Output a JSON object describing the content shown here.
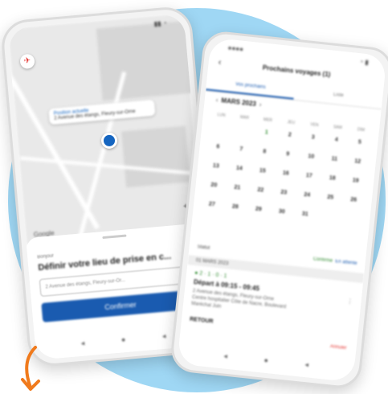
{
  "phone1": {
    "status_time": "",
    "callout": {
      "title": "Position actuelle",
      "text": "2 Avenue des étangs, Fleury-sur-Orne"
    },
    "map_brand": "Google",
    "sheet": {
      "kicker": "Bonjour",
      "title": "Définir votre lieu de prise en c...",
      "address_value": "2 Avenue des étangs, Fleury-sur-Or...",
      "confirm_label": "Confirmer"
    },
    "icons": [
      "compass-icon",
      "location-pin-icon",
      "locate-icon",
      "search-icon"
    ]
  },
  "phone2": {
    "title": "Prochains voyages (1)",
    "tabs": [
      {
        "label": "Vos prochains"
      },
      {
        "label": "Liste"
      }
    ],
    "month": "MARS 2023",
    "days_of_week": [
      "LUN",
      "MAR",
      "MER",
      "JEU",
      "VEN",
      "SAM",
      "DIM"
    ],
    "weeks": [
      [
        "",
        "",
        "1",
        "2",
        "3",
        "4",
        "5"
      ],
      [
        "6",
        "7",
        "8",
        "9",
        "10",
        "11",
        "12"
      ],
      [
        "13",
        "14",
        "15",
        "16",
        "17",
        "18",
        "19"
      ],
      [
        "20",
        "21",
        "22",
        "23",
        "24",
        "25",
        "26"
      ],
      [
        "27",
        "28",
        "29",
        "30",
        "31",
        "",
        ""
      ],
      [
        "",
        "",
        "",
        "",
        "",
        "",
        ""
      ]
    ],
    "legend": {
      "left": "Statut",
      "confirmed": "Confirmé",
      "pending": "En attente"
    },
    "day_header": "01 MARS 2023",
    "trip": {
      "badges": "● 2 · 1 · 0 · 1",
      "departure": "Départ à 09:15 - 09:45",
      "line1": "2 Avenue des étangs, Fleury-sur-Orne",
      "line2": "Centre hospitalier Côte de Nacre, Boulevard",
      "line3": "Maréchal Juin"
    },
    "retour": "RETOUR",
    "cancel": "Annuler"
  },
  "colors": {
    "accent": "#1a5bb0",
    "confirmed": "#2e8b2e",
    "cancel": "#e53935",
    "blob": "#9fd7f4",
    "arrow": "#f07a1c"
  }
}
